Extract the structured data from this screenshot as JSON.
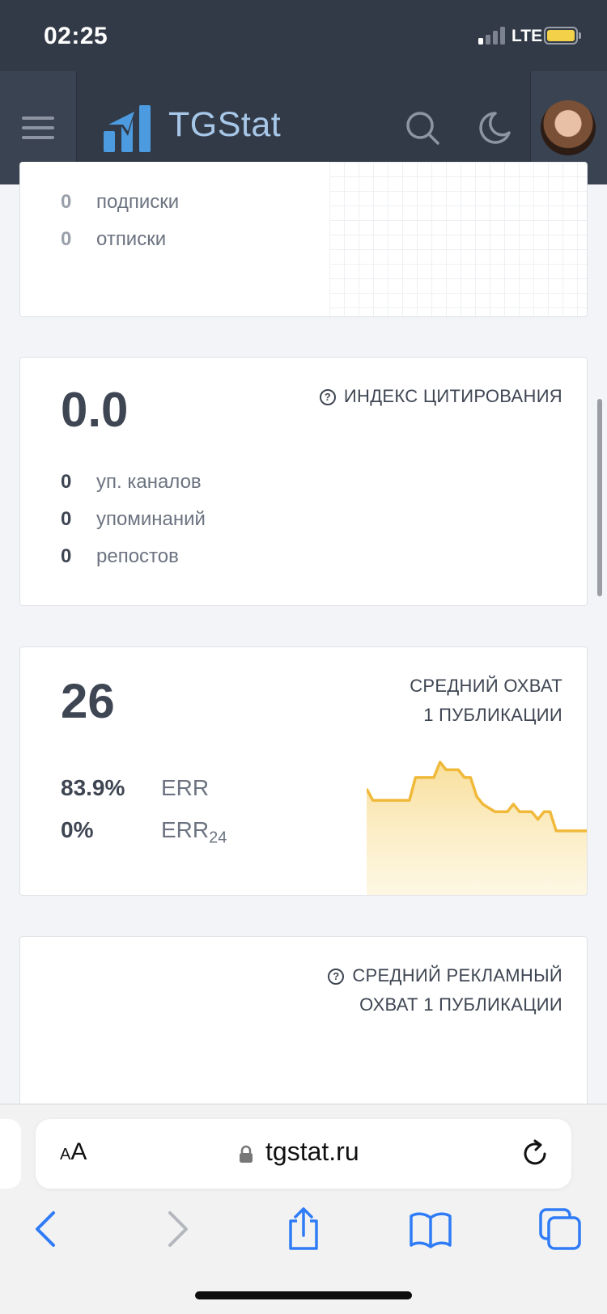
{
  "status_bar": {
    "time": "02:25",
    "network": "LTE"
  },
  "header": {
    "logo_text": "TGStat"
  },
  "card_subscriptions": {
    "rows": [
      {
        "value": "0",
        "label": "подписки"
      },
      {
        "value": "0",
        "label": "отписки"
      }
    ]
  },
  "card_citation": {
    "value": "0.0",
    "title": "ИНДЕКС ЦИТИРОВАНИЯ",
    "rows": [
      {
        "value": "0",
        "label": "уп. каналов"
      },
      {
        "value": "0",
        "label": "упоминаний"
      },
      {
        "value": "0",
        "label": "репостов"
      }
    ]
  },
  "card_reach": {
    "value": "26",
    "title_line1": "СРЕДНИЙ ОХВАТ",
    "title_line2": "1 ПУБЛИКАЦИИ",
    "err": {
      "value": "83.9%",
      "label": "ERR"
    },
    "err24": {
      "value": "0%",
      "label": "ERR",
      "sub": "24"
    },
    "chart_data": {
      "type": "area",
      "color": "#f0b93a",
      "values": [
        21,
        18,
        18,
        18,
        18,
        18,
        18,
        18,
        24,
        24,
        24,
        24,
        28,
        26,
        26,
        26,
        24,
        24,
        19,
        17,
        16,
        15,
        15,
        15,
        17,
        15,
        15,
        15,
        13,
        15,
        15,
        10,
        10,
        10,
        10,
        10,
        10
      ]
    }
  },
  "card_ad_reach": {
    "title_line1": "СРЕДНИЙ РЕКЛАМНЫЙ",
    "title_line2": "ОХВАТ 1 ПУБЛИКАЦИИ"
  },
  "browser": {
    "url": "tgstat.ru",
    "text_size_label_small": "A",
    "text_size_label_big": "A"
  },
  "colors": {
    "header_bg": "#323a47",
    "logo_blue": "#4c9be0",
    "accent_yellow": "#f0b93a"
  }
}
